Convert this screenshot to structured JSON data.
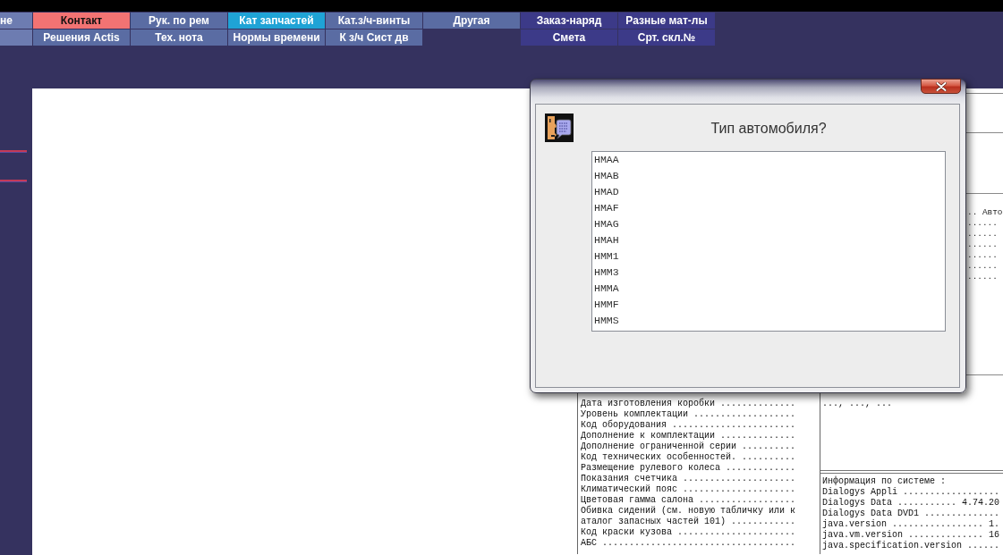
{
  "menu": {
    "rows": [
      [
        {
          "label": "не",
          "kind": "module",
          "selected": false,
          "highlighted": false
        },
        {
          "label": "Контакт",
          "kind": "module",
          "selected": true,
          "highlighted": false
        },
        {
          "label": "Рук. по рем",
          "kind": "module",
          "selected": false,
          "highlighted": false
        },
        {
          "label": "Кат запчастей",
          "kind": "module",
          "selected": false,
          "highlighted": true
        },
        {
          "label": "Кат.з/ч-винты",
          "kind": "module",
          "selected": false,
          "highlighted": false
        },
        {
          "label": "Другая",
          "kind": "module",
          "selected": false,
          "highlighted": false
        },
        {
          "label": "Заказ-наряд",
          "kind": "order",
          "selected": false,
          "highlighted": false
        },
        {
          "label": "Разные мат-лы",
          "kind": "order",
          "selected": false,
          "highlighted": false
        }
      ],
      [
        {
          "kind": "blank"
        },
        {
          "label": "Решения Actis",
          "kind": "module",
          "selected": false,
          "highlighted": false
        },
        {
          "label": "Тех. нота",
          "kind": "module",
          "selected": false,
          "highlighted": false
        },
        {
          "label": "Нормы времени",
          "kind": "module",
          "selected": false,
          "highlighted": false
        },
        {
          "label": "К з/ч Сист дв",
          "kind": "module",
          "selected": false,
          "highlighted": false
        },
        {
          "kind": "empty"
        },
        {
          "label": "Смета",
          "kind": "order",
          "selected": false,
          "highlighted": false
        },
        {
          "label": "Срт. скл.№",
          "kind": "order",
          "selected": false,
          "highlighted": false
        }
      ]
    ]
  },
  "document": {
    "side_lines": [
      ".. Авто",
      "......",
      "......",
      "......",
      "......",
      "......",
      "......"
    ],
    "vehicle_fields": [
      "Дата изготовления коробки ..............",
      "Уровень комплектации ...................",
      "Код оборудования .......................",
      "Дополнение к комплектации ..............",
      "Дополнение ограниченной серии ..........",
      "Код технических особенностей. ..........",
      "Размещение рулевого колеса .............",
      "Показания счетчика .....................",
      "Климатический пояс .....................",
      "Цветовая гамма салона ..................",
      "Обивка сидений (см. новую табличку или к",
      "аталог запасных частей 101) ............",
      "Код краски кузова ......................",
      "АБС ...................................."
    ],
    "notes": [
      "..., ..., ..."
    ],
    "system_info": [
      "Информация по системе :",
      "Dialogys Appli ..................",
      "Dialogys Data ........... 4.74.20",
      "Dialogys Data DVD1 ..............",
      "java.version ................. 1.",
      "java.vm.version .............. 16",
      "java.specification.version ......"
    ]
  },
  "dialog": {
    "prompt": "Тип автомобиля?",
    "options": [
      {
        "label": "HMAA",
        "selected": false
      },
      {
        "label": "HMAB",
        "selected": false
      },
      {
        "label": "HMAD",
        "selected": false
      },
      {
        "label": "HMAF",
        "selected": false
      },
      {
        "label": "HMAG",
        "selected": false
      },
      {
        "label": "HMAH",
        "selected": false
      },
      {
        "label": "HMM1",
        "selected": false
      },
      {
        "label": "HMM3",
        "selected": false
      },
      {
        "label": "HMMA",
        "selected": false
      },
      {
        "label": "HMMF",
        "selected": false
      },
      {
        "label": "HMMS",
        "selected": false
      }
    ]
  }
}
